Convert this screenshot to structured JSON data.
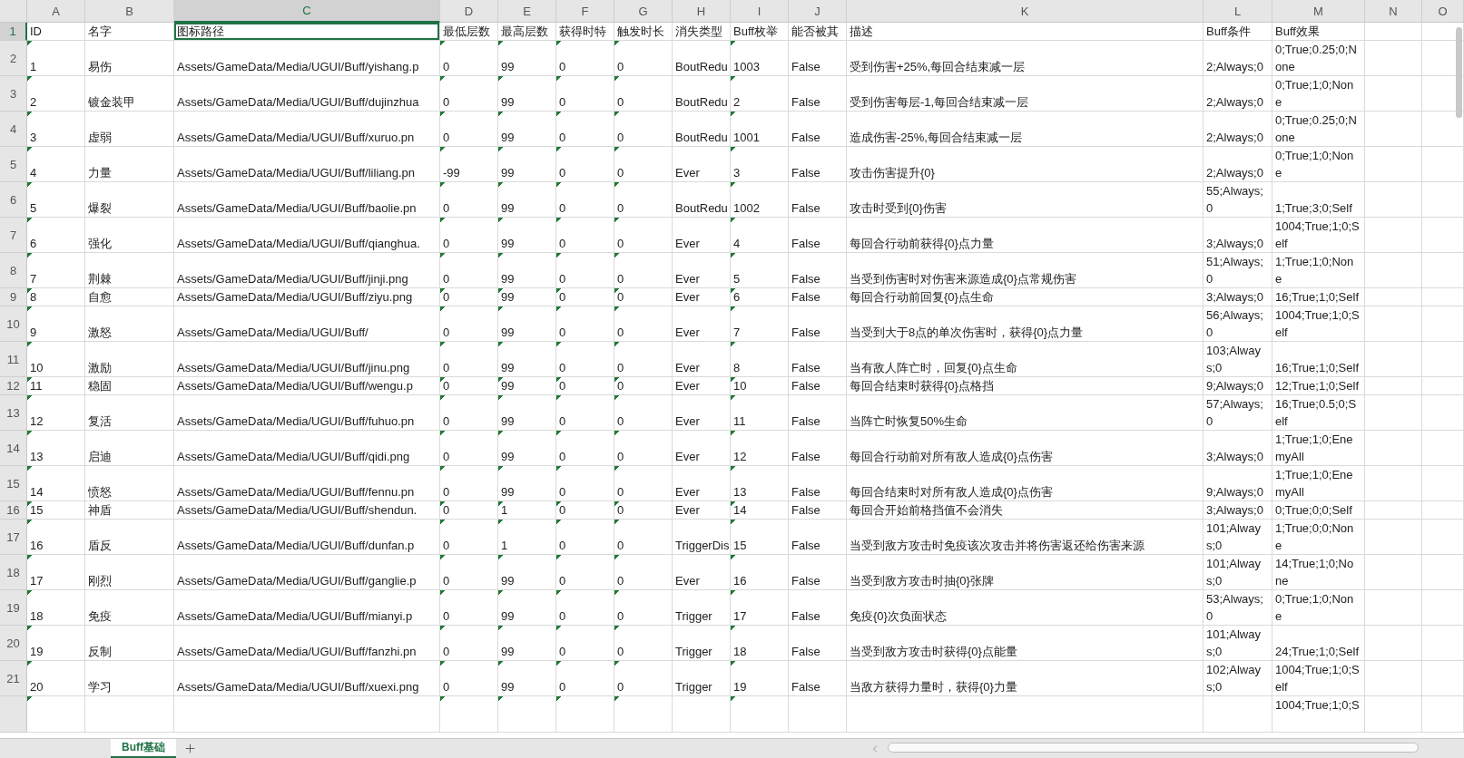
{
  "columns": [
    {
      "letter": "A",
      "selected": false,
      "warning": true
    },
    {
      "letter": "B",
      "selected": false,
      "warning": false
    },
    {
      "letter": "C",
      "selected": true,
      "warning": false
    },
    {
      "letter": "D",
      "selected": false,
      "warning": true
    },
    {
      "letter": "E",
      "selected": false,
      "warning": true
    },
    {
      "letter": "F",
      "selected": false,
      "warning": true
    },
    {
      "letter": "G",
      "selected": false,
      "warning": true
    },
    {
      "letter": "H",
      "selected": false,
      "warning": false
    },
    {
      "letter": "I",
      "selected": false,
      "warning": true
    },
    {
      "letter": "J",
      "selected": false,
      "warning": false
    },
    {
      "letter": "K",
      "selected": false,
      "warning": false
    },
    {
      "letter": "L",
      "selected": false,
      "warning": false
    },
    {
      "letter": "M",
      "selected": false,
      "warning": false
    },
    {
      "letter": "N",
      "selected": false,
      "warning": false
    },
    {
      "letter": "O",
      "selected": false,
      "warning": false
    }
  ],
  "rows": [
    {
      "number": "1",
      "selected": true,
      "cells": {
        "A": "ID",
        "B": "名字",
        "C": "图标路径",
        "D": "最低层数",
        "E": "最高层数",
        "F": "获得时特",
        "G": "触发时长",
        "H": "消失类型",
        "I": "Buff枚举",
        "J": "能否被其",
        "K": "描述",
        "L": "Buff条件",
        "M": "Buff效果"
      }
    },
    {
      "number": "2",
      "selected": false,
      "cells": {
        "A": "1",
        "B": "易伤",
        "C": "Assets/GameData/Media/UGUI/Buff/yishang.p",
        "D": "0",
        "E": "99",
        "F": "0",
        "G": "0",
        "H": "BoutRedu",
        "I": "1003",
        "J": "False",
        "K": "受到伤害+25%,每回合结束减一层",
        "L": "2;Always;0",
        "M": "0;True;0.25;0;None"
      }
    },
    {
      "number": "3",
      "selected": false,
      "cells": {
        "A": "2",
        "B": "镀金装甲",
        "C": "Assets/GameData/Media/UGUI/Buff/dujinzhua",
        "D": "0",
        "E": "99",
        "F": "0",
        "G": "0",
        "H": "BoutRedu",
        "I": "2",
        "J": "False",
        "K": "受到伤害每层-1,每回合结束减一层",
        "L": "2;Always;0",
        "M": "0;True;1;0;None"
      }
    },
    {
      "number": "4",
      "selected": false,
      "cells": {
        "A": "3",
        "B": "虚弱",
        "C": "Assets/GameData/Media/UGUI/Buff/xuruo.pn",
        "D": "0",
        "E": "99",
        "F": "0",
        "G": "0",
        "H": "BoutRedu",
        "I": "1001",
        "J": "False",
        "K": "造成伤害-25%,每回合结束减一层",
        "L": "2;Always;0",
        "M": "0;True;0.25;0;None"
      }
    },
    {
      "number": "5",
      "selected": false,
      "cells": {
        "A": "4",
        "B": "力量",
        "C": "Assets/GameData/Media/UGUI/Buff/liliang.pn",
        "D": "-99",
        "E": "99",
        "F": "0",
        "G": "0",
        "H": "Ever",
        "I": "3",
        "J": "False",
        "K": "攻击伤害提升{0}",
        "L": "2;Always;0",
        "M": "0;True;1;0;None"
      }
    },
    {
      "number": "6",
      "selected": false,
      "cells": {
        "A": "5",
        "B": "爆裂",
        "C": "Assets/GameData/Media/UGUI/Buff/baolie.pn",
        "D": "0",
        "E": "99",
        "F": "0",
        "G": "0",
        "H": "BoutRedu",
        "I": "1002",
        "J": "False",
        "K": "攻击时受到{0}伤害",
        "L": "55;Always;0",
        "M": "1;True;3;0;Self"
      }
    },
    {
      "number": "7",
      "selected": false,
      "cells": {
        "A": "6",
        "B": "强化",
        "C": "Assets/GameData/Media/UGUI/Buff/qianghua.",
        "D": "0",
        "E": "99",
        "F": "0",
        "G": "0",
        "H": "Ever",
        "I": "4",
        "J": "False",
        "K": "每回合行动前获得{0}点力量",
        "L": "3;Always;0",
        "M": "1004;True;1;0;Self"
      }
    },
    {
      "number": "8",
      "selected": false,
      "cells": {
        "A": "7",
        "B": "荆棘",
        "C": "Assets/GameData/Media/UGUI/Buff/jinji.png",
        "D": "0",
        "E": "99",
        "F": "0",
        "G": "0",
        "H": "Ever",
        "I": "5",
        "J": "False",
        "K": "当受到伤害时对伤害来源造成{0}点常规伤害",
        "L": "51;Always;0",
        "M": "1;True;1;0;None"
      }
    },
    {
      "number": "9",
      "selected": false,
      "cells": {
        "A": "8",
        "B": "自愈",
        "C": "Assets/GameData/Media/UGUI/Buff/ziyu.png",
        "D": "0",
        "E": "99",
        "F": "0",
        "G": "0",
        "H": "Ever",
        "I": "6",
        "J": "False",
        "K": "每回合行动前回复{0}点生命",
        "L": "3;Always;0",
        "M": "16;True;1;0;Self"
      }
    },
    {
      "number": "10",
      "selected": false,
      "cells": {
        "A": "9",
        "B": "激怒",
        "C": "Assets/GameData/Media/UGUI/Buff/",
        "D": "0",
        "E": "99",
        "F": "0",
        "G": "0",
        "H": "Ever",
        "I": "7",
        "J": "False",
        "K": "当受到大于8点的单次伤害时，获得{0}点力量",
        "L": "56;Always;0",
        "M": "1004;True;1;0;Self"
      }
    },
    {
      "number": "11",
      "selected": false,
      "cells": {
        "A": "10",
        "B": "激励",
        "C": "Assets/GameData/Media/UGUI/Buff/jinu.png",
        "D": "0",
        "E": "99",
        "F": "0",
        "G": "0",
        "H": "Ever",
        "I": "8",
        "J": "False",
        "K": "当有敌人阵亡时，回复{0}点生命",
        "L": "103;Always;0",
        "M": "16;True;1;0;Self"
      }
    },
    {
      "number": "12",
      "selected": false,
      "cells": {
        "A": "11",
        "B": "稳固",
        "C": "Assets/GameData/Media/UGUI/Buff/wengu.p",
        "D": "0",
        "E": "99",
        "F": "0",
        "G": "0",
        "H": "Ever",
        "I": "10",
        "J": "False",
        "K": "每回合结束时获得{0}点格挡",
        "L": "9;Always;0",
        "M": "12;True;1;0;Self"
      }
    },
    {
      "number": "13",
      "selected": false,
      "cells": {
        "A": "12",
        "B": "复活",
        "C": "Assets/GameData/Media/UGUI/Buff/fuhuo.pn",
        "D": "0",
        "E": "99",
        "F": "0",
        "G": "0",
        "H": "Ever",
        "I": "11",
        "J": "False",
        "K": "当阵亡时恢复50%生命",
        "L": "57;Always;0",
        "M": "16;True;0.5;0;Self"
      }
    },
    {
      "number": "14",
      "selected": false,
      "cells": {
        "A": "13",
        "B": "启迪",
        "C": "Assets/GameData/Media/UGUI/Buff/qidi.png",
        "D": "0",
        "E": "99",
        "F": "0",
        "G": "0",
        "H": "Ever",
        "I": "12",
        "J": "False",
        "K": "每回合行动前对所有敌人造成{0}点伤害",
        "L": "3;Always;0",
        "M": "1;True;1;0;EnemyAll"
      }
    },
    {
      "number": "15",
      "selected": false,
      "cells": {
        "A": "14",
        "B": "愤怒",
        "C": "Assets/GameData/Media/UGUI/Buff/fennu.pn",
        "D": "0",
        "E": "99",
        "F": "0",
        "G": "0",
        "H": "Ever",
        "I": "13",
        "J": "False",
        "K": "每回合结束时对所有敌人造成{0}点伤害",
        "L": "9;Always;0",
        "M": "1;True;1;0;EnemyAll"
      }
    },
    {
      "number": "16",
      "selected": false,
      "cells": {
        "A": "15",
        "B": "神盾",
        "C": "Assets/GameData/Media/UGUI/Buff/shendun.",
        "D": "0",
        "E": "1",
        "F": "0",
        "G": "0",
        "H": "Ever",
        "I": "14",
        "J": "False",
        "K": "每回合开始前格挡值不会消失",
        "L": "3;Always;0",
        "M": "0;True;0;0;Self"
      }
    },
    {
      "number": "17",
      "selected": false,
      "cells": {
        "A": "16",
        "B": "盾反",
        "C": "Assets/GameData/Media/UGUI/Buff/dunfan.p",
        "D": "0",
        "E": "1",
        "F": "0",
        "G": "0",
        "H": "TriggerDis",
        "I": "15",
        "J": "False",
        "K": "当受到敌方攻击时免疫该次攻击并将伤害返还给伤害来源",
        "L": "101;Always;0",
        "M": "1;True;0;0;None"
      }
    },
    {
      "number": "18",
      "selected": false,
      "cells": {
        "A": "17",
        "B": "刚烈",
        "C": "Assets/GameData/Media/UGUI/Buff/ganglie.p",
        "D": "0",
        "E": "99",
        "F": "0",
        "G": "0",
        "H": "Ever",
        "I": "16",
        "J": "False",
        "K": "当受到敌方攻击时抽{0}张牌",
        "L": "101;Always;0",
        "M": "14;True;1;0;None"
      }
    },
    {
      "number": "19",
      "selected": false,
      "cells": {
        "A": "18",
        "B": "免疫",
        "C": "Assets/GameData/Media/UGUI/Buff/mianyi.p",
        "D": "0",
        "E": "99",
        "F": "0",
        "G": "0",
        "H": "Trigger",
        "I": "17",
        "J": "False",
        "K": "免疫{0}次负面状态",
        "L": "53;Always;0",
        "M": "0;True;1;0;None"
      }
    },
    {
      "number": "20",
      "selected": false,
      "cells": {
        "A": "19",
        "B": "反制",
        "C": "Assets/GameData/Media/UGUI/Buff/fanzhi.pn",
        "D": "0",
        "E": "99",
        "F": "0",
        "G": "0",
        "H": "Trigger",
        "I": "18",
        "J": "False",
        "K": "当受到敌方攻击时获得{0}点能量",
        "L": "101;Always;0",
        "M": "24;True;1;0;Self"
      }
    },
    {
      "number": "21",
      "selected": false,
      "cells": {
        "A": "20",
        "B": "学习",
        "C": "Assets/GameData/Media/UGUI/Buff/xuexi.png",
        "D": "0",
        "E": "99",
        "F": "0",
        "G": "0",
        "H": "Trigger",
        "I": "19",
        "J": "False",
        "K": "当敌方获得力量时，获得{0}力量",
        "L": "102;Always;0",
        "M": "1004;True;1;0;Self"
      }
    },
    {
      "selected": false,
      "cells": {
        "M": "1004;True;1;0;S"
      }
    }
  ],
  "sheet_tabs": [
    {
      "label": "Buff基础",
      "selected": true
    }
  ]
}
